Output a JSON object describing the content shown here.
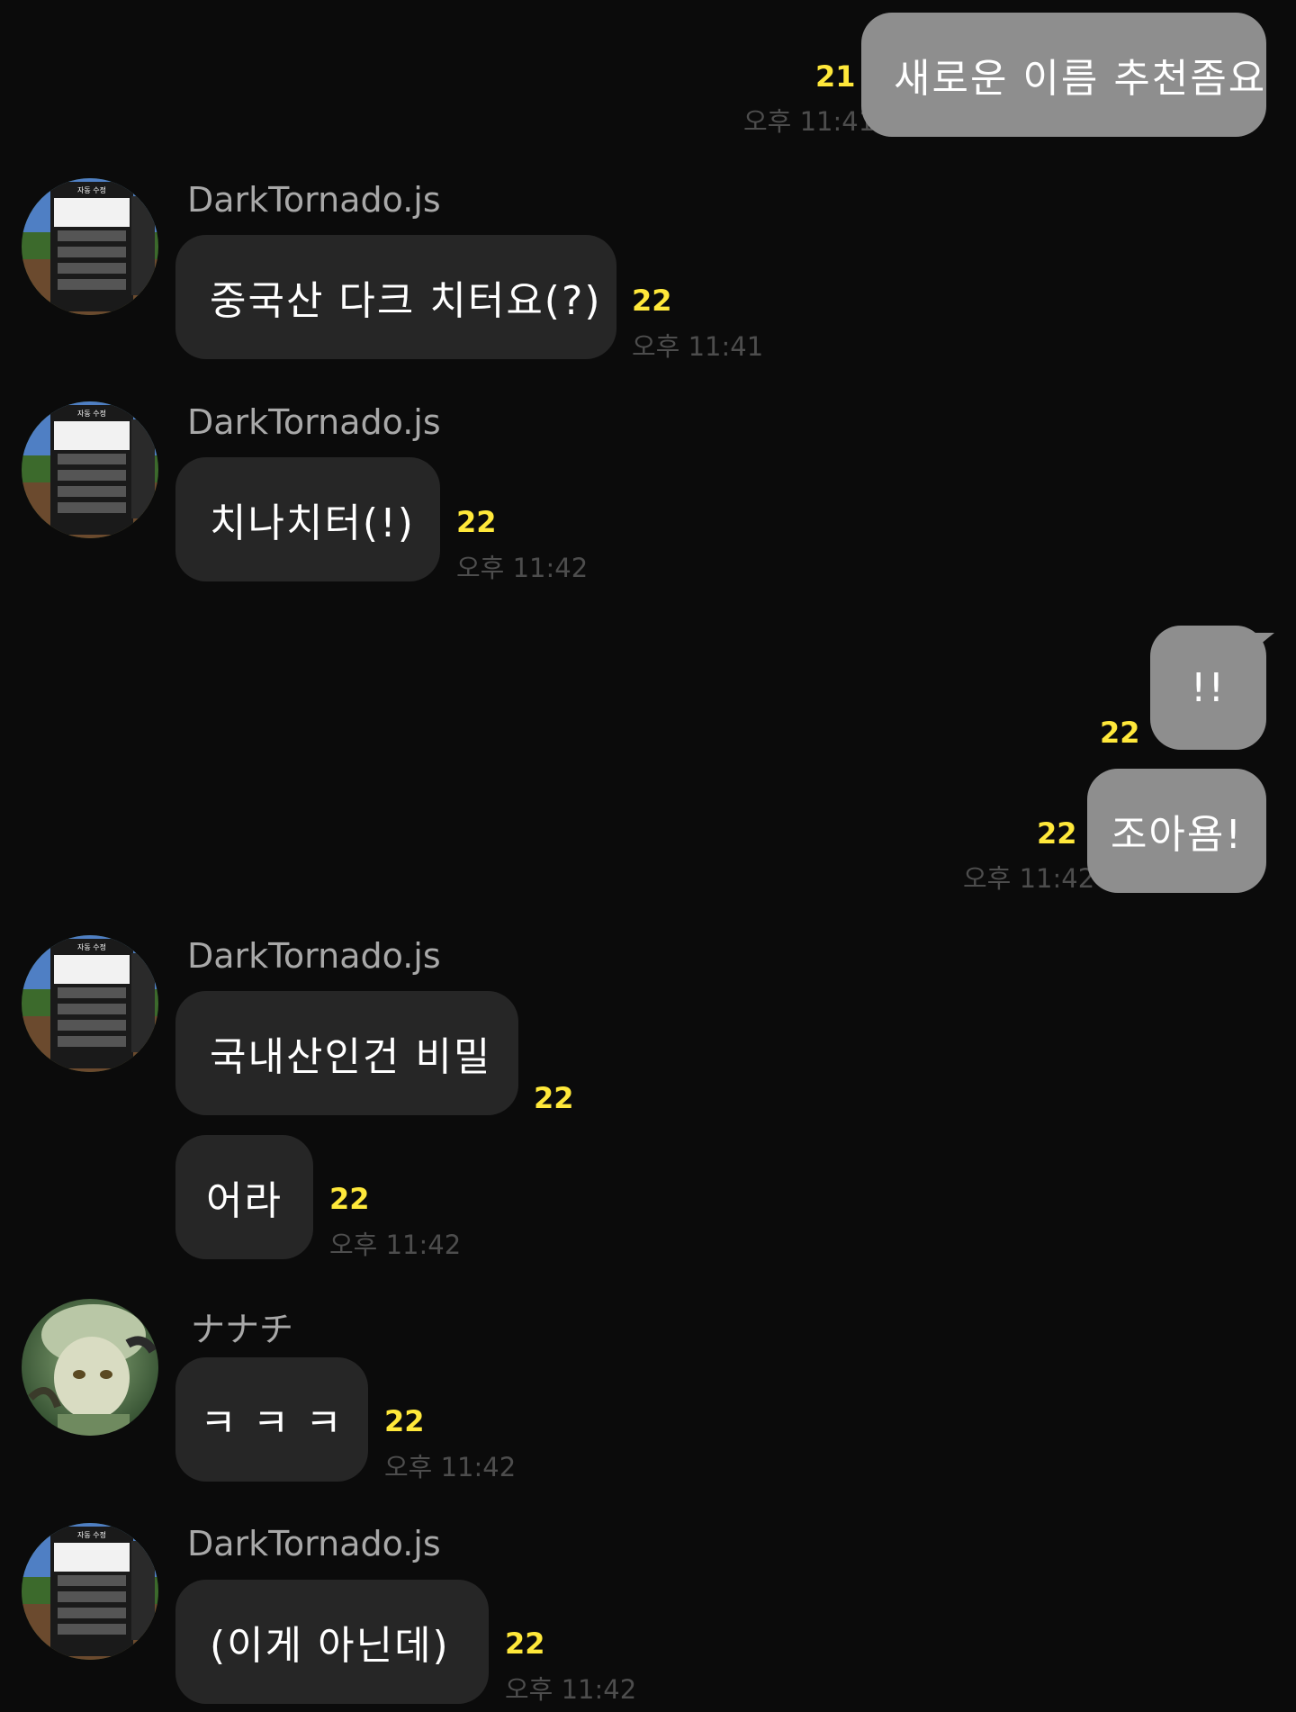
{
  "messages": [
    {
      "sender": "me",
      "text": "새로운 이름 추천좀요",
      "unread": "21",
      "time": "오후 11:41"
    },
    {
      "sender": "DarkTornado.js",
      "text": "중국산 다크 치터요(?)",
      "unread": "22",
      "time": "오후 11:41"
    },
    {
      "sender": "DarkTornado.js",
      "text": "치나치터(!)",
      "unread": "22",
      "time": "오후 11:42"
    },
    {
      "sender": "me",
      "text": "!!",
      "unread": "22"
    },
    {
      "sender": "me",
      "text": "조아욤!",
      "unread": "22",
      "time": "오후 11:42"
    },
    {
      "sender": "DarkTornado.js",
      "text": "국내산인건 비밀",
      "unread": "22"
    },
    {
      "sender": "DarkTornado.js",
      "text": "어라",
      "unread": "22",
      "time": "오후 11:42"
    },
    {
      "sender": "ナナチ",
      "text": "ㅋ ㅋ ㅋ",
      "unread": "22",
      "time": "오후 11:42"
    },
    {
      "sender": "DarkTornado.js",
      "text": "(이게 아닌데)",
      "unread": "22",
      "time": "오후 11:42"
    }
  ],
  "avatars": {
    "darktornado": {
      "icon": "app-settings-screenshot-avatar",
      "menu_title": "자동 수정"
    },
    "nanachi": {
      "icon": "anime-character-avatar"
    }
  },
  "colors": {
    "background": "#0b0b0b",
    "my_bubble": "#8e8e8e",
    "other_bubble": "#262626",
    "unread_count": "#ffe83a",
    "time_text": "#4d4d4d",
    "name_text": "#a8a8a8"
  }
}
